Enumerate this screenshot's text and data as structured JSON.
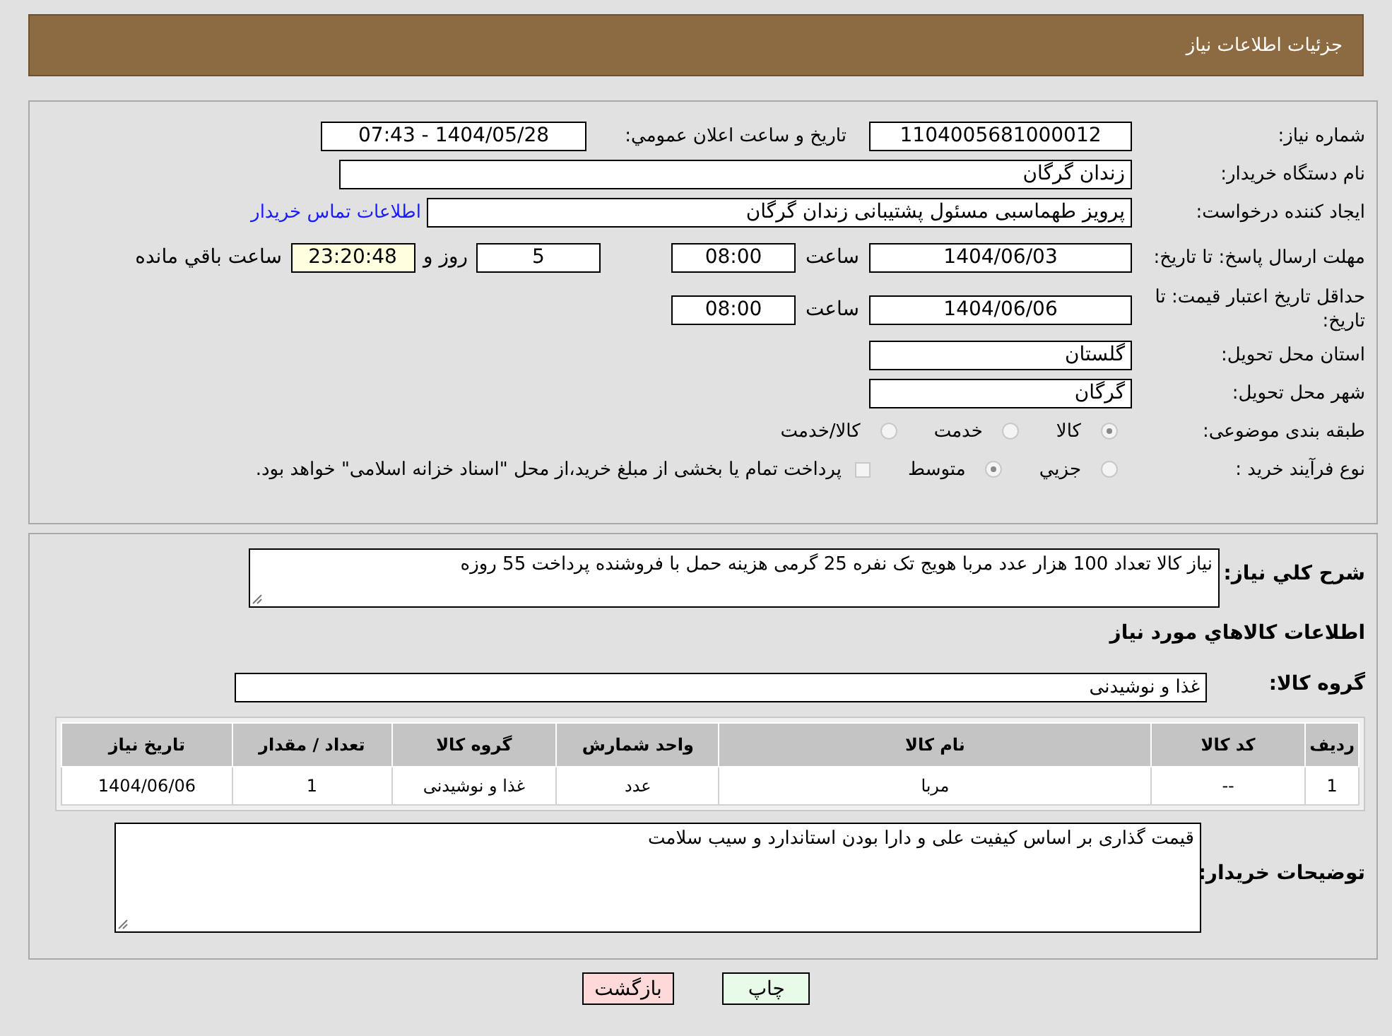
{
  "header": {
    "title": "جزئیات اطلاعات نیاز"
  },
  "need_number": {
    "label": "شماره نیاز:",
    "value": "1104005681000012"
  },
  "announce": {
    "label": "تاریخ و ساعت اعلان عمومي:",
    "value": "1404/05/28 - 07:43"
  },
  "buyer_org": {
    "label": "نام دستگاه خریدار:",
    "value": "زندان گرگان"
  },
  "requester": {
    "label": "ایجاد کننده درخواست:",
    "value": "پرویز طهماسبی مسئول پشتیبانی زندان گرگان",
    "contact_link": "اطلاعات تماس خریدار"
  },
  "reply_deadline": {
    "label": "مهلت ارسال پاسخ: تا تاریخ:",
    "date": "1404/06/03",
    "time_label": "ساعت",
    "time": "08:00",
    "days": "5",
    "days_label": "روز و",
    "remaining": "23:20:48",
    "remaining_label": "ساعت باقي مانده"
  },
  "price_validity": {
    "label": "حداقل تاریخ اعتبار قیمت: تا تاریخ:",
    "date": "1404/06/06",
    "time_label": "ساعت",
    "time": "08:00"
  },
  "province": {
    "label": "استان محل تحویل:",
    "value": "گلستان"
  },
  "city": {
    "label": "شهر محل تحویل:",
    "value": "گرگان"
  },
  "category": {
    "label": "طبقه بندی موضوعی:",
    "options": [
      {
        "label": "کالا",
        "selected": true
      },
      {
        "label": "خدمت",
        "selected": false
      },
      {
        "label": "کالا/خدمت",
        "selected": false
      }
    ]
  },
  "purchase_type": {
    "label": "نوع فرآیند خرید :",
    "options": [
      {
        "kind": "radio",
        "label": "جزيي",
        "selected": false
      },
      {
        "kind": "radio",
        "label": "متوسط",
        "selected": true
      },
      {
        "kind": "checkbox",
        "label": "پرداخت تمام یا بخشی از مبلغ خرید،از محل \"اسناد خزانه اسلامی\" خواهد بود.",
        "checked": false
      }
    ]
  },
  "description": {
    "label": "شرح کلي نیاز:",
    "value": "نیاز کالا تعداد 100 هزار عدد مربا هویج  تک نفره 25 گرمی هزینه حمل با فروشنده پرداخت 55 روزه"
  },
  "goods_title": "اطلاعات کالاهاي مورد نیاز",
  "goods_group": {
    "label": "گروه کالا:",
    "value": "غذا و نوشیدنی"
  },
  "table": {
    "columns": [
      "ردیف",
      "کد کالا",
      "نام کالا",
      "واحد شمارش",
      "گروه کالا",
      "تعداد / مقدار",
      "تاریخ نیاز"
    ],
    "rows": [
      [
        "1",
        "--",
        "مربا",
        "عدد",
        "غذا و نوشیدنی",
        "1",
        "1404/06/06"
      ]
    ]
  },
  "buyer_notes": {
    "label": "توضیحات خریدار:",
    "value": "قیمت گذاری بر اساس کیفیت علی و دارا بودن استاندارد و سیب سلامت"
  },
  "buttons": [
    {
      "kind": "print",
      "label": "چاپ"
    },
    {
      "kind": "back",
      "label": "بازگشت"
    }
  ]
}
